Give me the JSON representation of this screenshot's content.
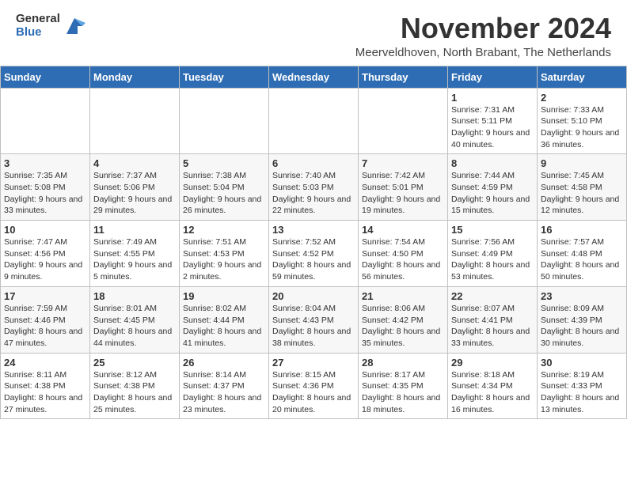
{
  "logo": {
    "general": "General",
    "blue": "Blue"
  },
  "title": "November 2024",
  "subtitle": "Meerveldhoven, North Brabant, The Netherlands",
  "days_of_week": [
    "Sunday",
    "Monday",
    "Tuesday",
    "Wednesday",
    "Thursday",
    "Friday",
    "Saturday"
  ],
  "weeks": [
    [
      {
        "day": "",
        "info": ""
      },
      {
        "day": "",
        "info": ""
      },
      {
        "day": "",
        "info": ""
      },
      {
        "day": "",
        "info": ""
      },
      {
        "day": "",
        "info": ""
      },
      {
        "day": "1",
        "info": "Sunrise: 7:31 AM\nSunset: 5:11 PM\nDaylight: 9 hours and 40 minutes."
      },
      {
        "day": "2",
        "info": "Sunrise: 7:33 AM\nSunset: 5:10 PM\nDaylight: 9 hours and 36 minutes."
      }
    ],
    [
      {
        "day": "3",
        "info": "Sunrise: 7:35 AM\nSunset: 5:08 PM\nDaylight: 9 hours and 33 minutes."
      },
      {
        "day": "4",
        "info": "Sunrise: 7:37 AM\nSunset: 5:06 PM\nDaylight: 9 hours and 29 minutes."
      },
      {
        "day": "5",
        "info": "Sunrise: 7:38 AM\nSunset: 5:04 PM\nDaylight: 9 hours and 26 minutes."
      },
      {
        "day": "6",
        "info": "Sunrise: 7:40 AM\nSunset: 5:03 PM\nDaylight: 9 hours and 22 minutes."
      },
      {
        "day": "7",
        "info": "Sunrise: 7:42 AM\nSunset: 5:01 PM\nDaylight: 9 hours and 19 minutes."
      },
      {
        "day": "8",
        "info": "Sunrise: 7:44 AM\nSunset: 4:59 PM\nDaylight: 9 hours and 15 minutes."
      },
      {
        "day": "9",
        "info": "Sunrise: 7:45 AM\nSunset: 4:58 PM\nDaylight: 9 hours and 12 minutes."
      }
    ],
    [
      {
        "day": "10",
        "info": "Sunrise: 7:47 AM\nSunset: 4:56 PM\nDaylight: 9 hours and 9 minutes."
      },
      {
        "day": "11",
        "info": "Sunrise: 7:49 AM\nSunset: 4:55 PM\nDaylight: 9 hours and 5 minutes."
      },
      {
        "day": "12",
        "info": "Sunrise: 7:51 AM\nSunset: 4:53 PM\nDaylight: 9 hours and 2 minutes."
      },
      {
        "day": "13",
        "info": "Sunrise: 7:52 AM\nSunset: 4:52 PM\nDaylight: 8 hours and 59 minutes."
      },
      {
        "day": "14",
        "info": "Sunrise: 7:54 AM\nSunset: 4:50 PM\nDaylight: 8 hours and 56 minutes."
      },
      {
        "day": "15",
        "info": "Sunrise: 7:56 AM\nSunset: 4:49 PM\nDaylight: 8 hours and 53 minutes."
      },
      {
        "day": "16",
        "info": "Sunrise: 7:57 AM\nSunset: 4:48 PM\nDaylight: 8 hours and 50 minutes."
      }
    ],
    [
      {
        "day": "17",
        "info": "Sunrise: 7:59 AM\nSunset: 4:46 PM\nDaylight: 8 hours and 47 minutes."
      },
      {
        "day": "18",
        "info": "Sunrise: 8:01 AM\nSunset: 4:45 PM\nDaylight: 8 hours and 44 minutes."
      },
      {
        "day": "19",
        "info": "Sunrise: 8:02 AM\nSunset: 4:44 PM\nDaylight: 8 hours and 41 minutes."
      },
      {
        "day": "20",
        "info": "Sunrise: 8:04 AM\nSunset: 4:43 PM\nDaylight: 8 hours and 38 minutes."
      },
      {
        "day": "21",
        "info": "Sunrise: 8:06 AM\nSunset: 4:42 PM\nDaylight: 8 hours and 35 minutes."
      },
      {
        "day": "22",
        "info": "Sunrise: 8:07 AM\nSunset: 4:41 PM\nDaylight: 8 hours and 33 minutes."
      },
      {
        "day": "23",
        "info": "Sunrise: 8:09 AM\nSunset: 4:39 PM\nDaylight: 8 hours and 30 minutes."
      }
    ],
    [
      {
        "day": "24",
        "info": "Sunrise: 8:11 AM\nSunset: 4:38 PM\nDaylight: 8 hours and 27 minutes."
      },
      {
        "day": "25",
        "info": "Sunrise: 8:12 AM\nSunset: 4:38 PM\nDaylight: 8 hours and 25 minutes."
      },
      {
        "day": "26",
        "info": "Sunrise: 8:14 AM\nSunset: 4:37 PM\nDaylight: 8 hours and 23 minutes."
      },
      {
        "day": "27",
        "info": "Sunrise: 8:15 AM\nSunset: 4:36 PM\nDaylight: 8 hours and 20 minutes."
      },
      {
        "day": "28",
        "info": "Sunrise: 8:17 AM\nSunset: 4:35 PM\nDaylight: 8 hours and 18 minutes."
      },
      {
        "day": "29",
        "info": "Sunrise: 8:18 AM\nSunset: 4:34 PM\nDaylight: 8 hours and 16 minutes."
      },
      {
        "day": "30",
        "info": "Sunrise: 8:19 AM\nSunset: 4:33 PM\nDaylight: 8 hours and 13 minutes."
      }
    ]
  ]
}
